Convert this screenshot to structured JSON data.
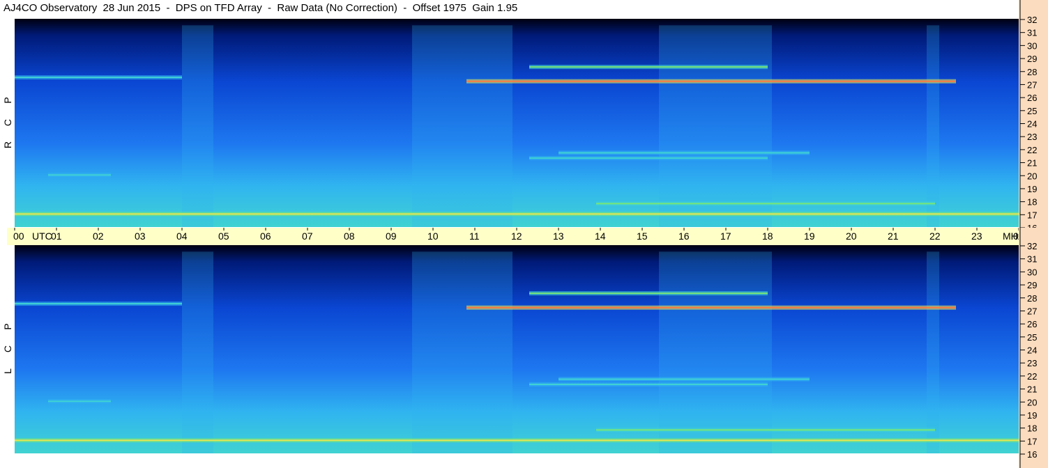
{
  "title": "AJ4CO Observatory  28 Jun 2015  -  DPS on TFD Array  -  Raw Data (No Correction)  -  Offset 1975  Gain 1.95",
  "panels": [
    {
      "id": "rcp",
      "letters": [
        "R",
        "C",
        "P"
      ]
    },
    {
      "id": "lcp",
      "letters": [
        "L",
        "C",
        "P"
      ]
    }
  ],
  "time_axis": {
    "labels": [
      "00",
      "01",
      "02",
      "03",
      "04",
      "05",
      "06",
      "07",
      "08",
      "09",
      "10",
      "11",
      "12",
      "13",
      "14",
      "15",
      "16",
      "17",
      "18",
      "19",
      "20",
      "21",
      "22",
      "23",
      "00"
    ],
    "unit": "UTC"
  },
  "freq_axis": {
    "labels": [
      "32",
      "31",
      "30",
      "29",
      "28",
      "27",
      "26",
      "25",
      "24",
      "23",
      "22",
      "21",
      "20",
      "19",
      "18",
      "17",
      "16"
    ],
    "unit": "MHz"
  },
  "colors": {
    "background": "#ffffff",
    "time_bar": "#ffffc8",
    "freq_axis": "#fcdcbe",
    "colormap": [
      "#000010",
      "#001a78",
      "#0a46d2",
      "#1e78f0",
      "#30b4f0",
      "#40d2d2",
      "#78e678",
      "#e6e650",
      "#ff7840",
      "#ff3cb4"
    ]
  },
  "chart_data": {
    "type": "heatmap",
    "title": "AJ4CO Observatory  28 Jun 2015  -  DPS on TFD Array  -  Raw Data (No Correction)  -  Offset 1975  Gain 1.95",
    "x_range_utc_hours": [
      0,
      24
    ],
    "y_range_mhz": [
      16,
      32
    ],
    "series": [
      {
        "name": "RCP",
        "bands": [
          {
            "mhz": 27.2,
            "level": 0.85,
            "t_start": 10.8,
            "t_end": 22.5
          },
          {
            "mhz": 28.3,
            "level": 0.7,
            "t_start": 12.3,
            "t_end": 18.0
          },
          {
            "mhz": 27.5,
            "level": 0.55,
            "t_start": 0.0,
            "t_end": 4.0
          },
          {
            "mhz": 17.0,
            "level": 0.75,
            "t_start": 0.0,
            "t_end": 24.0
          },
          {
            "mhz": 17.8,
            "level": 0.7,
            "t_start": 13.9,
            "t_end": 22.0
          },
          {
            "mhz": 21.3,
            "level": 0.6,
            "t_start": 12.3,
            "t_end": 18.0
          },
          {
            "mhz": 20.0,
            "level": 0.6,
            "t_start": 0.8,
            "t_end": 2.3
          },
          {
            "mhz": 21.7,
            "level": 0.55,
            "t_start": 13.0,
            "t_end": 19.0
          }
        ]
      },
      {
        "name": "LCP",
        "bands": [
          {
            "mhz": 27.2,
            "level": 0.85,
            "t_start": 10.8,
            "t_end": 22.5
          },
          {
            "mhz": 28.3,
            "level": 0.7,
            "t_start": 12.3,
            "t_end": 18.0
          },
          {
            "mhz": 27.5,
            "level": 0.55,
            "t_start": 0.0,
            "t_end": 4.0
          },
          {
            "mhz": 17.0,
            "level": 0.75,
            "t_start": 0.0,
            "t_end": 24.0
          },
          {
            "mhz": 17.8,
            "level": 0.7,
            "t_start": 13.9,
            "t_end": 22.0
          },
          {
            "mhz": 21.3,
            "level": 0.6,
            "t_start": 12.3,
            "t_end": 18.0
          },
          {
            "mhz": 20.0,
            "level": 0.6,
            "t_start": 0.8,
            "t_end": 2.3
          },
          {
            "mhz": 21.7,
            "level": 0.55,
            "t_start": 13.0,
            "t_end": 19.0
          }
        ]
      }
    ],
    "bright_columns_utc": [
      [
        4.0,
        4.75
      ],
      [
        9.5,
        11.9
      ],
      [
        15.4,
        18.1
      ],
      [
        21.8,
        22.1
      ]
    ],
    "grid": false
  }
}
